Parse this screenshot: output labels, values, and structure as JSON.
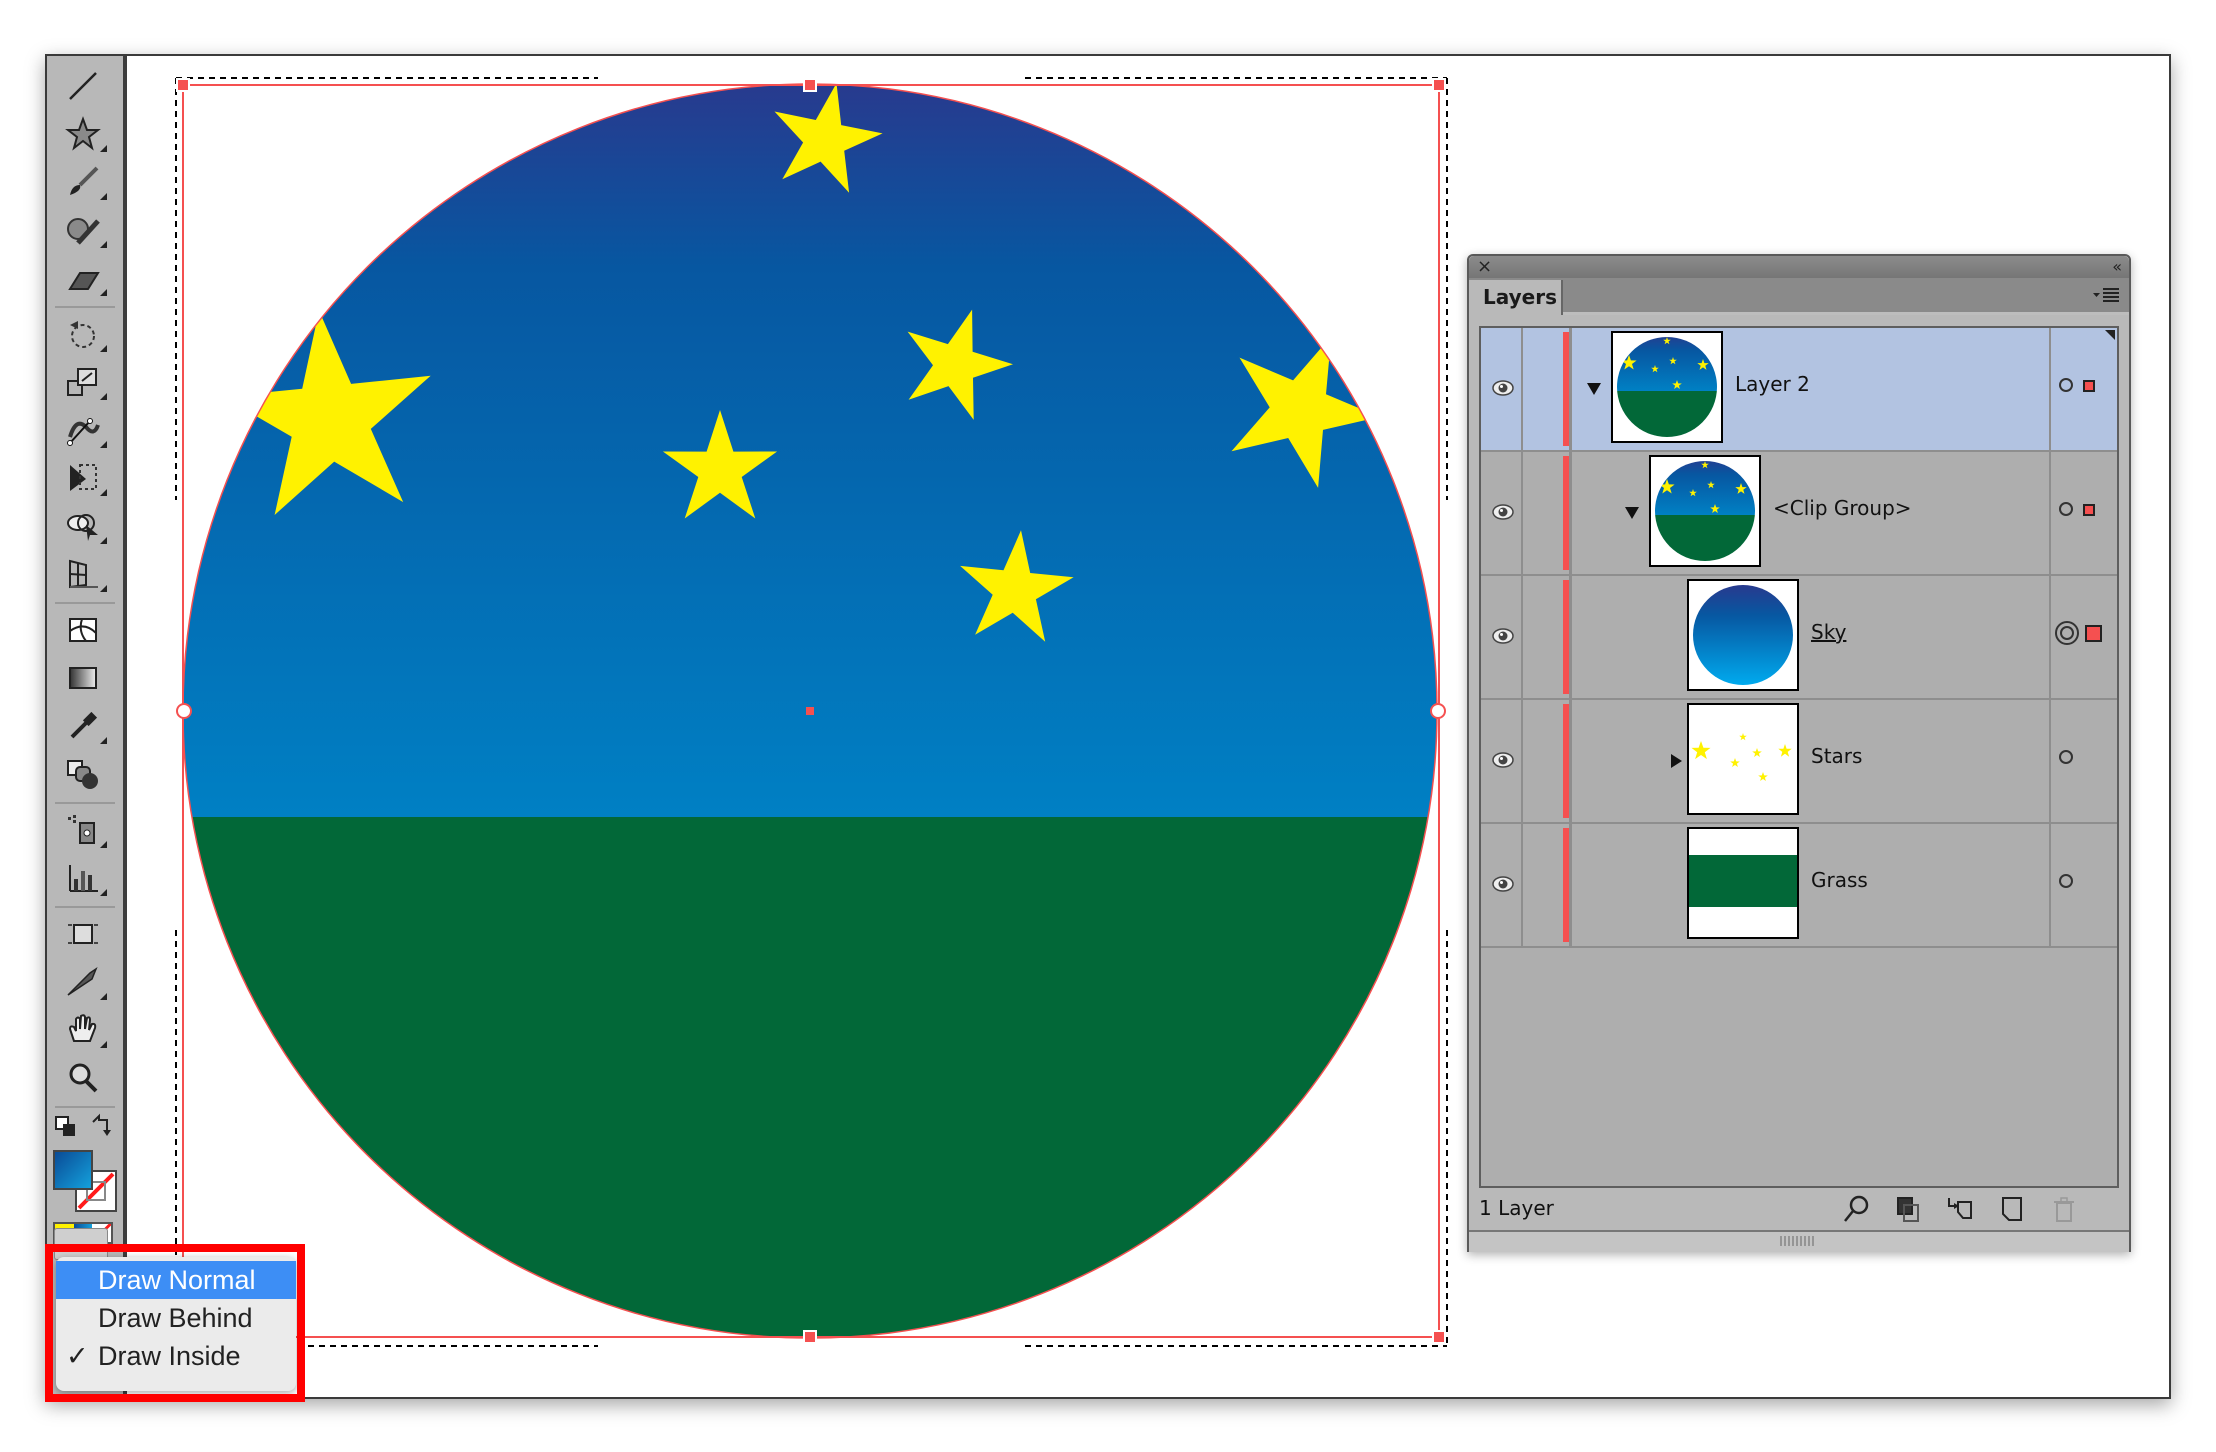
{
  "app": {
    "name": "Illustrator document window"
  },
  "toolbar": {
    "tools": [
      {
        "name": "line-segment-tool",
        "icon": "line-icon"
      },
      {
        "name": "star-tool",
        "icon": "star-icon"
      },
      {
        "name": "paintbrush-tool",
        "icon": "paintbrush-icon"
      },
      {
        "name": "shaper-tool",
        "icon": "shaper-icon"
      },
      {
        "name": "eraser-tool",
        "icon": "eraser-icon"
      },
      {
        "name": "rotate-tool",
        "icon": "rotate-icon"
      },
      {
        "name": "scale-tool",
        "icon": "scale-icon"
      },
      {
        "name": "width-tool",
        "icon": "width-icon"
      },
      {
        "name": "free-transform-tool",
        "icon": "free-transform-icon"
      },
      {
        "name": "shape-builder-tool",
        "icon": "shape-builder-icon"
      },
      {
        "name": "perspective-grid-tool",
        "icon": "perspective-grid-icon"
      },
      {
        "name": "mesh-tool",
        "icon": "mesh-icon"
      },
      {
        "name": "gradient-tool",
        "icon": "gradient-icon"
      },
      {
        "name": "eyedropper-tool",
        "icon": "eyedropper-icon"
      },
      {
        "name": "blend-tool",
        "icon": "blend-icon"
      },
      {
        "name": "symbol-sprayer-tool",
        "icon": "symbol-sprayer-icon"
      },
      {
        "name": "column-graph-tool",
        "icon": "column-graph-icon"
      },
      {
        "name": "artboard-tool",
        "icon": "artboard-icon"
      },
      {
        "name": "slice-tool",
        "icon": "slice-icon"
      },
      {
        "name": "hand-tool",
        "icon": "hand-icon"
      },
      {
        "name": "zoom-tool",
        "icon": "zoom-icon"
      }
    ],
    "fill_color": "#0b62b0",
    "stroke": "none"
  },
  "artwork": {
    "sky_top_color": "#283a8e",
    "sky_mid_color": "#0757a1",
    "sky_bottom_color": "#0080c4",
    "grass_color": "#026838",
    "star_color": "#fff200",
    "selection_color": "#f55050"
  },
  "draw_mode_menu": {
    "items": [
      {
        "label": "Draw Normal",
        "highlighted": true,
        "checked": false
      },
      {
        "label": "Draw Behind",
        "highlighted": false,
        "checked": false
      },
      {
        "label": "Draw Inside",
        "highlighted": false,
        "checked": true
      }
    ],
    "check_glyph": "✓"
  },
  "layers_panel": {
    "close_glyph": "×",
    "collapse_glyph": "‹‹",
    "tab_label": "Layers",
    "layers": [
      {
        "name": "Layer 2",
        "expanded": true,
        "twisty": "down",
        "selected": true,
        "visible": true,
        "thumbnail": "full-scene",
        "target": "circle",
        "selection_square": true,
        "underline": false
      },
      {
        "name": "<Clip Group>",
        "expanded": true,
        "twisty": "down",
        "selected": false,
        "visible": true,
        "thumbnail": "full-scene",
        "target": "circle",
        "selection_square": true,
        "underline": false
      },
      {
        "name": "Sky",
        "expanded": false,
        "twisty": "none",
        "selected": false,
        "visible": true,
        "thumbnail": "sky",
        "target": "double-circle",
        "selection_square": true,
        "underline": true
      },
      {
        "name": "Stars",
        "expanded": false,
        "twisty": "right",
        "selected": false,
        "visible": true,
        "thumbnail": "stars",
        "target": "circle",
        "selection_square": false,
        "underline": false
      },
      {
        "name": "Grass",
        "expanded": false,
        "twisty": "none",
        "selected": false,
        "visible": true,
        "thumbnail": "grass",
        "target": "circle",
        "selection_square": false,
        "underline": false
      }
    ],
    "footer": {
      "layer_count": "1 Layer",
      "buttons": [
        "locate-object",
        "make-clipping-mask",
        "create-sublayer",
        "create-new-layer",
        "delete-selection"
      ]
    }
  }
}
